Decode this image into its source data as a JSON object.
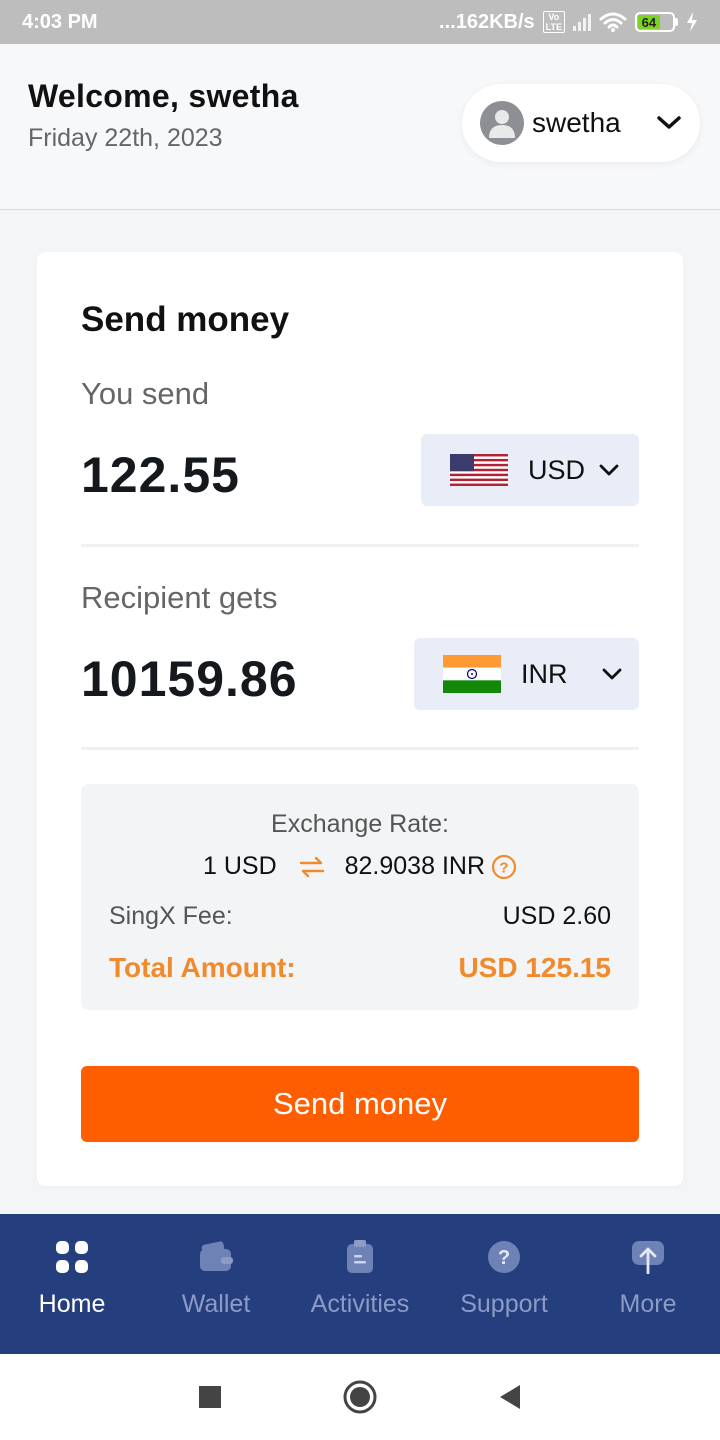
{
  "status_bar": {
    "time": "4:03 PM",
    "network_speed": "...162KB/s",
    "volte": "Vo LTE",
    "battery": "64",
    "battery_level": 0.64
  },
  "header": {
    "welcome": "Welcome, swetha",
    "date": "Friday 22th, 2023",
    "user_name": "swetha"
  },
  "send_card": {
    "title": "Send money",
    "you_send_label": "You send",
    "you_send_amount": "122.55",
    "send_currency": "USD",
    "recipient_label": "Recipient gets",
    "recipient_amount": "10159.86",
    "recipient_currency": "INR",
    "exchange_rate_label": "Exchange Rate:",
    "rate_from": "1 USD",
    "rate_to": "82.9038 INR",
    "fee_label": "SingX Fee:",
    "fee_value": "USD 2.60",
    "total_label": "Total Amount:",
    "total_value": "USD 125.15",
    "button_label": "Send money"
  },
  "bottom_nav": {
    "items": [
      {
        "label": "Home",
        "icon": "grid-icon",
        "active": true
      },
      {
        "label": "Wallet",
        "icon": "wallet-icon",
        "active": false
      },
      {
        "label": "Activities",
        "icon": "clipboard-icon",
        "active": false
      },
      {
        "label": "Support",
        "icon": "help-circle-icon",
        "active": false
      },
      {
        "label": "More",
        "icon": "upload-icon",
        "active": false
      }
    ]
  },
  "colors": {
    "accent": "#FF5E00",
    "total": "#F08A2C",
    "nav_bg": "#253F7E",
    "nav_inactive": "#8B9BC6"
  }
}
